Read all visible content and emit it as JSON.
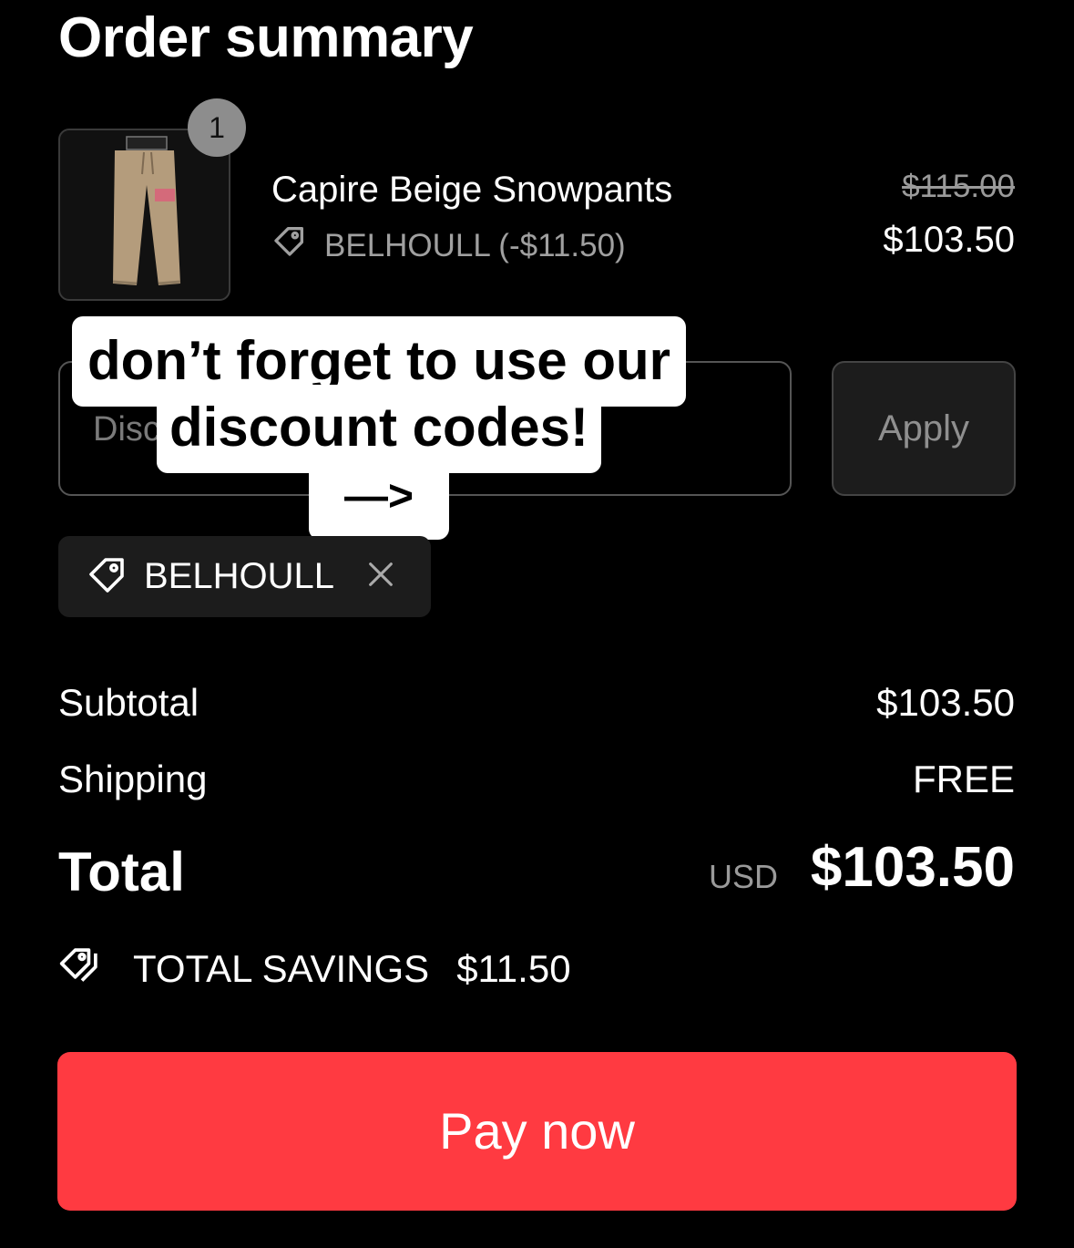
{
  "header": {
    "title": "Order summary"
  },
  "item": {
    "quantity": "1",
    "name": "Capire Beige Snowpants",
    "discount_line": "BELHOULL (-$11.50)",
    "original_price": "$115.00",
    "price": "$103.50"
  },
  "discount": {
    "placeholder": "Discount code or gift card",
    "apply_label": "Apply",
    "applied_code": "BELHOULL"
  },
  "overlay": {
    "line1": "don’t forget to use our",
    "line2": "discount codes!",
    "line3": "—>"
  },
  "totals": {
    "subtotal_label": "Subtotal",
    "subtotal_value": "$103.50",
    "shipping_label": "Shipping",
    "shipping_value": "FREE",
    "total_label": "Total",
    "currency": "USD",
    "total_value": "$103.50",
    "savings_label": "TOTAL SAVINGS",
    "savings_value": "$11.50"
  },
  "pay_button": {
    "label": "Pay now"
  },
  "colors": {
    "accent": "#ff3a41",
    "background": "#000000"
  },
  "icons": [
    "tag-icon",
    "close-icon",
    "tags-icon"
  ]
}
